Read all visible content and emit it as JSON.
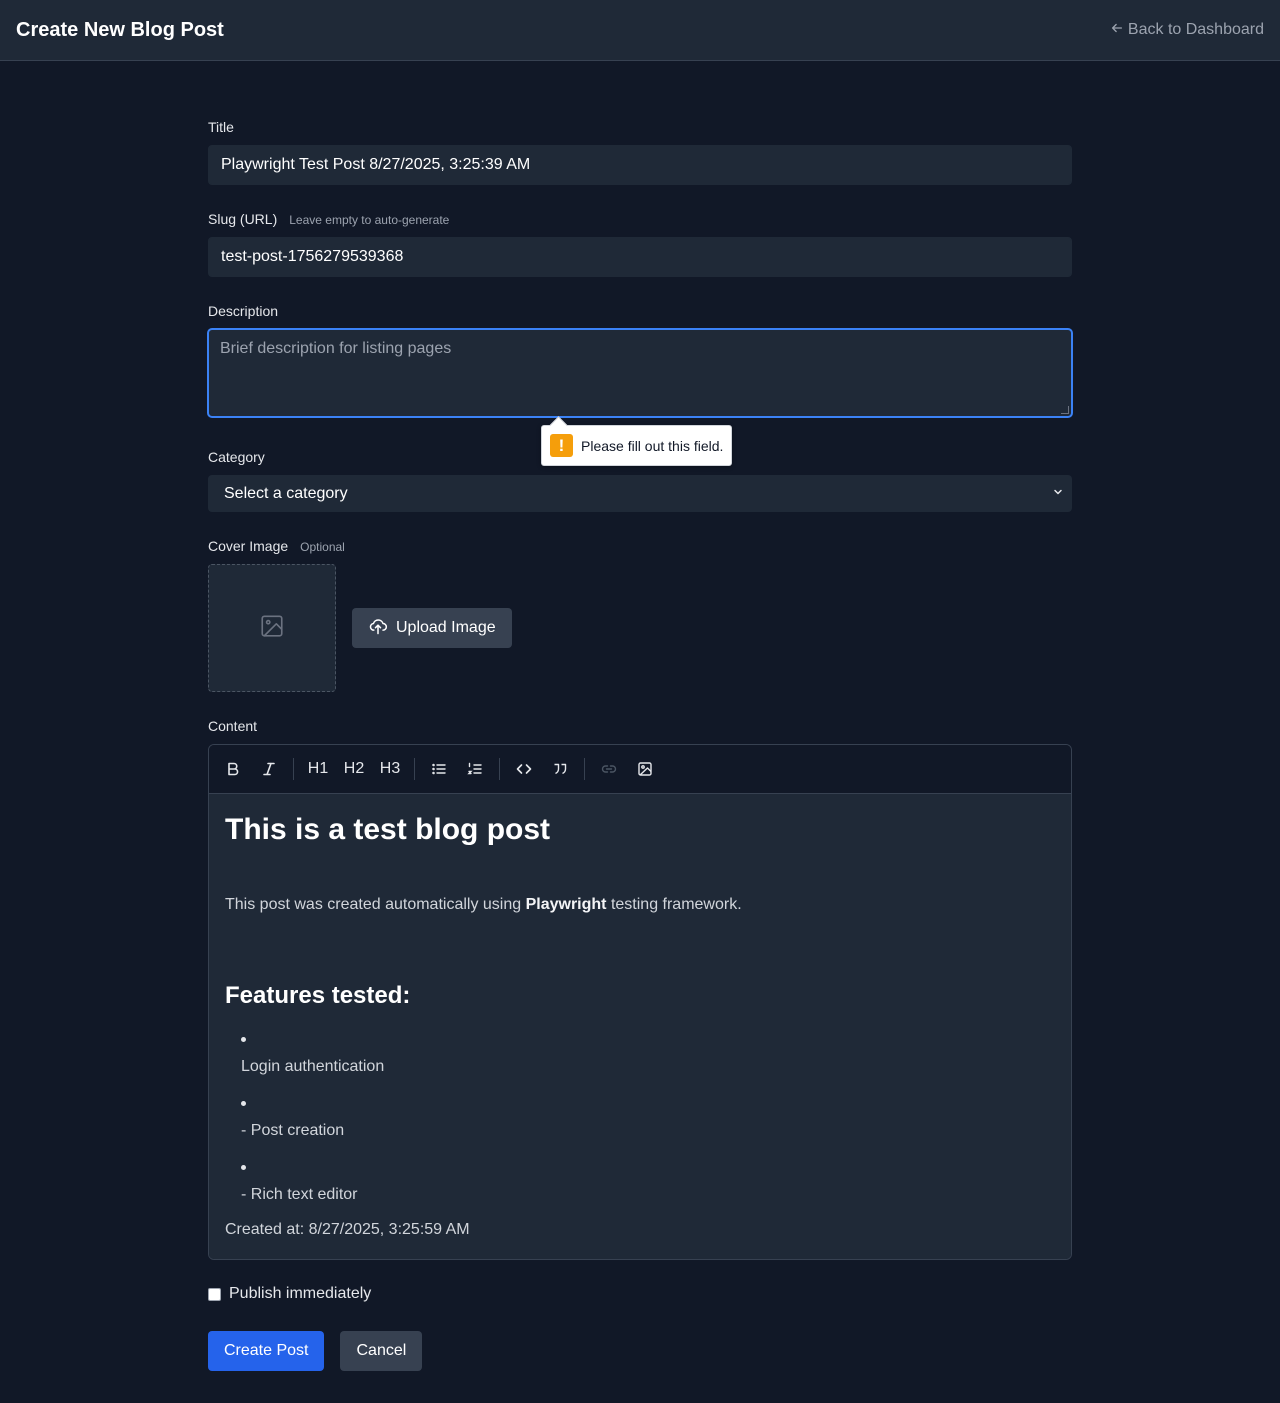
{
  "header": {
    "title": "Create New Blog Post",
    "back_label": "Back to Dashboard"
  },
  "form": {
    "title_label": "Title",
    "title_value": "Playwright Test Post 8/27/2025, 3:25:39 AM",
    "slug_label": "Slug (URL)",
    "slug_hint": "Leave empty to auto-generate",
    "slug_value": "test-post-1756279539368",
    "description_label": "Description",
    "description_placeholder": "Brief description for listing pages",
    "validation_message": "Please fill out this field.",
    "category_label": "Category",
    "category_selected": "Select a category",
    "cover_label": "Cover Image",
    "cover_hint": "Optional",
    "upload_label": "Upload Image",
    "content_label": "Content",
    "publish_label": "Publish immediately",
    "publish_checked": false,
    "create_label": "Create Post",
    "cancel_label": "Cancel"
  },
  "toolbar": {
    "bold": "B",
    "italic": "I",
    "h1": "H1",
    "h2": "H2",
    "h3": "H3",
    "icons": [
      "bullet-list-icon",
      "ordered-list-icon",
      "code-icon",
      "quote-icon",
      "link-icon",
      "image-icon"
    ]
  },
  "content": {
    "heading": "This is a test blog post",
    "para_before": "This post was created automatically using ",
    "para_bold": "Playwright",
    "para_after": " testing framework.",
    "subheading": "Features tested:",
    "list": [
      "Login authentication",
      "- Post creation",
      "- Rich text editor"
    ],
    "created_at": "Created at: 8/27/2025, 3:25:59 AM"
  },
  "colors": {
    "background": "#111827",
    "surface": "#1f2937",
    "accent": "#2563eb",
    "focus_ring": "#3b82f6",
    "warning": "#f59e0b"
  }
}
